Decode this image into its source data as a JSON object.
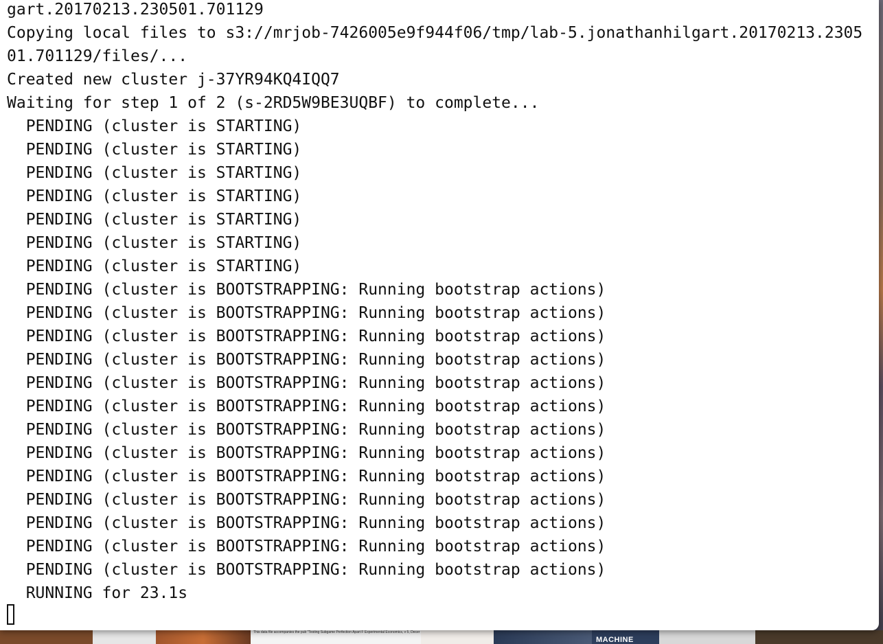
{
  "terminal": {
    "lines": [
      "gart.20170213.230501.701129",
      "Copying local files to s3://mrjob-7426005e9f944f06/tmp/lab-5.jonathanhilgart.20170213.2305",
      "01.701129/files/...",
      "Created new cluster j-37YR94KQ4IQQ7",
      "Waiting for step 1 of 2 (s-2RD5W9BE3UQBF) to complete...",
      "  PENDING (cluster is STARTING)",
      "  PENDING (cluster is STARTING)",
      "  PENDING (cluster is STARTING)",
      "  PENDING (cluster is STARTING)",
      "  PENDING (cluster is STARTING)",
      "  PENDING (cluster is STARTING)",
      "  PENDING (cluster is STARTING)",
      "  PENDING (cluster is BOOTSTRAPPING: Running bootstrap actions)",
      "  PENDING (cluster is BOOTSTRAPPING: Running bootstrap actions)",
      "  PENDING (cluster is BOOTSTRAPPING: Running bootstrap actions)",
      "  PENDING (cluster is BOOTSTRAPPING: Running bootstrap actions)",
      "  PENDING (cluster is BOOTSTRAPPING: Running bootstrap actions)",
      "  PENDING (cluster is BOOTSTRAPPING: Running bootstrap actions)",
      "  PENDING (cluster is BOOTSTRAPPING: Running bootstrap actions)",
      "  PENDING (cluster is BOOTSTRAPPING: Running bootstrap actions)",
      "  PENDING (cluster is BOOTSTRAPPING: Running bootstrap actions)",
      "  PENDING (cluster is BOOTSTRAPPING: Running bootstrap actions)",
      "  PENDING (cluster is BOOTSTRAPPING: Running bootstrap actions)",
      "  PENDING (cluster is BOOTSTRAPPING: Running bootstrap actions)",
      "  PENDING (cluster is BOOTSTRAPPING: Running bootstrap actions)",
      "  RUNNING for 23.1s"
    ]
  },
  "desktop": {
    "thumbnails": [
      {
        "name": "photo-thumb",
        "text": "",
        "color": "#7a4a2a"
      },
      {
        "name": "blank-thumb",
        "text": "",
        "color": "#e8e8e8"
      },
      {
        "name": "photo-thumb",
        "text": "",
        "color": "#a0552c"
      },
      {
        "name": "document-thumb",
        "text": "This data file accompanies the pub \"Testing Subgame Perfection Apart F Experimental Economics, v 5, Decer",
        "color": "#f4f4f4"
      },
      {
        "name": "document-thumb",
        "text": "",
        "color": "#f0ece8"
      },
      {
        "name": "photo-thumb",
        "text": "",
        "color": "#3a4a66"
      },
      {
        "name": "book-thumb",
        "text": "MACHINE",
        "color": "#2d3e5c"
      },
      {
        "name": "photo-thumb",
        "text": "",
        "color": "#d8d8d8"
      },
      {
        "name": "photo-thumb",
        "text": "",
        "color": "#4a3a2a"
      }
    ]
  }
}
